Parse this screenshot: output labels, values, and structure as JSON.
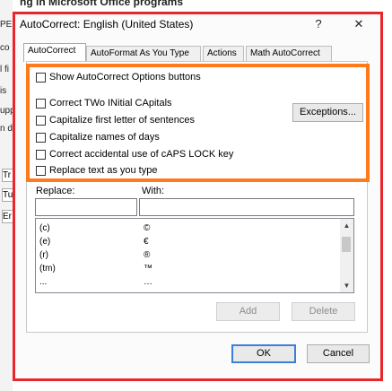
{
  "background": {
    "title_fragment": "ng in Microsoft Office programs",
    "left_fragments": [
      "PE",
      "co",
      "l fi",
      "is",
      "upp",
      "n d"
    ],
    "left_boxes": [
      "Tr",
      "Tu",
      "Er"
    ]
  },
  "dialog": {
    "title": "AutoCorrect: English (United States)",
    "help": "?",
    "close": "✕"
  },
  "tabs": [
    "AutoCorrect",
    "AutoFormat As You Type",
    "Actions",
    "Math AutoCorrect"
  ],
  "options": {
    "show_buttons": "Show AutoCorrect Options buttons",
    "two_initial": "Correct TWo INitial CApitals",
    "capitalize_first": "Capitalize first letter of sentences",
    "capitalize_days": "Capitalize names of days",
    "caps_lock": "Correct accidental use of cAPS LOCK key",
    "replace_text": "Replace text as you type",
    "exceptions": "Exceptions..."
  },
  "replace": {
    "replace_label": "Replace:",
    "with_label": "With:",
    "rows": [
      {
        "replace": "(c)",
        "with": "©"
      },
      {
        "replace": "(e)",
        "with": "€"
      },
      {
        "replace": "(r)",
        "with": "®"
      },
      {
        "replace": "(tm)",
        "with": "™"
      },
      {
        "replace": "...",
        "with": "…"
      }
    ],
    "add": "Add",
    "delete": "Delete"
  },
  "footer": {
    "ok": "OK",
    "cancel": "Cancel"
  },
  "colors": {
    "red_highlight": "#e8262b",
    "orange_highlight": "#ff7a1a",
    "ok_border": "#3c7fd6"
  }
}
